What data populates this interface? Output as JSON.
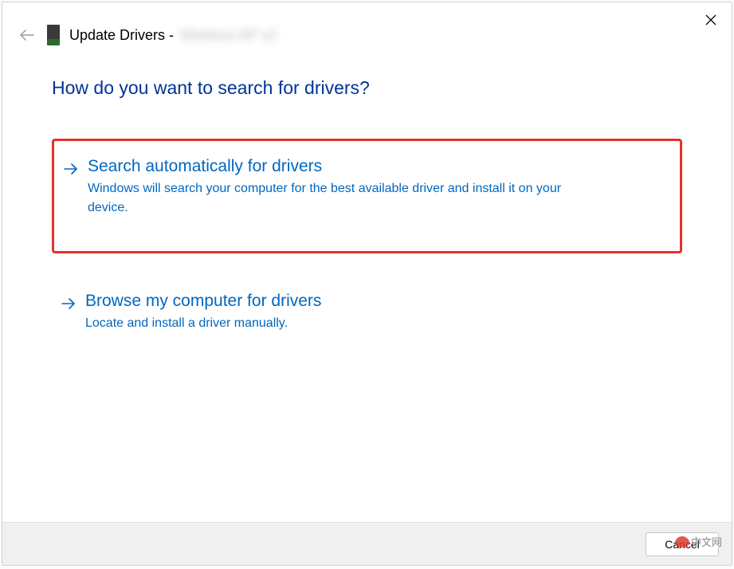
{
  "window": {
    "title_prefix": "Update Drivers -",
    "title_device": "Wireless AP v2"
  },
  "heading": "How do you want to search for drivers?",
  "options": [
    {
      "title": "Search automatically for drivers",
      "description": "Windows will search your computer for the best available driver and install it on your device.",
      "highlighted": true
    },
    {
      "title": "Browse my computer for drivers",
      "description": "Locate and install a driver manually.",
      "highlighted": false
    }
  ],
  "footer": {
    "cancel_label": "Cancel"
  },
  "watermark": {
    "text": "中文网",
    "brand": "php"
  },
  "highlight_color": "#e4322b",
  "link_color": "#0067c0"
}
